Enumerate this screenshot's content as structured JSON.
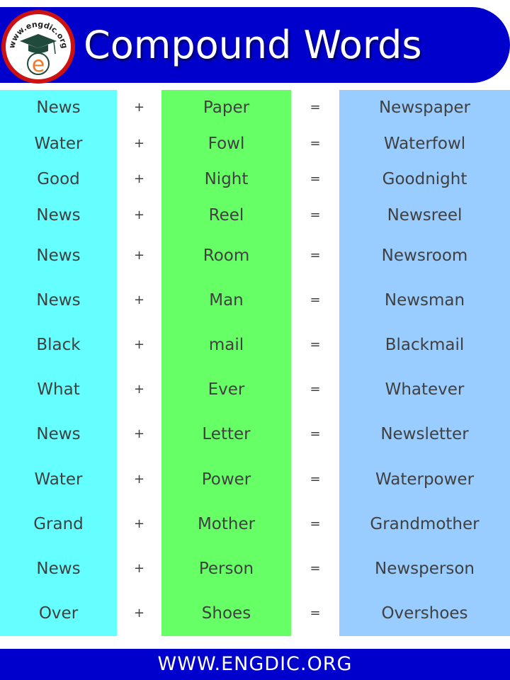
{
  "header": {
    "title": "Compound Words",
    "logo_text": "www.engdic.org",
    "logo_letter": "e",
    "colors": {
      "banner": "#0000cc",
      "logo_ring": "#cc1111"
    }
  },
  "columns": {
    "colors": {
      "first": "#66ffff",
      "second": "#66ff66",
      "result": "#99ccff"
    }
  },
  "rows": [
    {
      "first": "News",
      "plus": "+",
      "second": "Paper",
      "equals": "=",
      "result": "Newspaper"
    },
    {
      "first": "Water",
      "plus": "+",
      "second": "Fowl",
      "equals": "=",
      "result": "Waterfowl"
    },
    {
      "first": "Good",
      "plus": "+",
      "second": "Night",
      "equals": "=",
      "result": "Goodnight"
    },
    {
      "first": "News",
      "plus": "+",
      "second": "Reel",
      "equals": "=",
      "result": "Newsreel"
    },
    {
      "first": "News",
      "plus": "+",
      "second": "Room",
      "equals": "=",
      "result": "Newsroom"
    },
    {
      "first": "News",
      "plus": "+",
      "second": "Man",
      "equals": "=",
      "result": "Newsman"
    },
    {
      "first": "Black",
      "plus": "+",
      "second": "mail",
      "equals": "=",
      "result": "Blackmail"
    },
    {
      "first": "What",
      "plus": "+",
      "second": "Ever",
      "equals": "=",
      "result": "Whatever"
    },
    {
      "first": "News",
      "plus": "+",
      "second": "Letter",
      "equals": "=",
      "result": "Newsletter"
    },
    {
      "first": "Water",
      "plus": "+",
      "second": "Power",
      "equals": "=",
      "result": "Waterpower"
    },
    {
      "first": "Grand",
      "plus": "+",
      "second": "Mother",
      "equals": "=",
      "result": "Grandmother"
    },
    {
      "first": "News",
      "plus": "+",
      "second": "Person",
      "equals": "=",
      "result": "Newsperson"
    },
    {
      "first": "Over",
      "plus": "+",
      "second": "Shoes",
      "equals": "=",
      "result": "Overshoes"
    }
  ],
  "footer": {
    "text": "WWW.ENGDIC.ORG"
  }
}
